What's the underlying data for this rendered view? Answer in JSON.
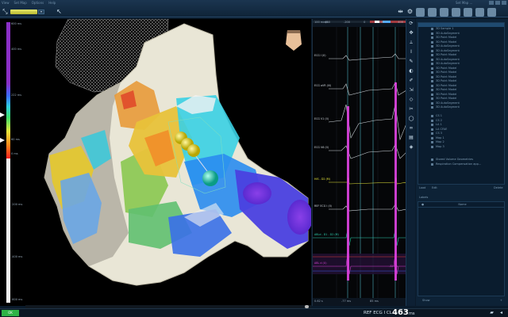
{
  "topbar": {
    "menu": [
      "View",
      "Set Map",
      "Options",
      "Help"
    ],
    "title_right": "Set Map ..."
  },
  "map_selector": {
    "value": "▾"
  },
  "scale": {
    "ticks": [
      {
        "label": "600 ms"
      },
      {
        "label": "400 ms"
      },
      {
        "label": "200 ms"
      },
      {
        "label": "0 ms"
      },
      {
        "label": "-200 ms"
      },
      {
        "label": "-400 ms"
      },
      {
        "label": "-600 ms"
      }
    ],
    "upper": "222 ms",
    "lower": "60 ms"
  },
  "ecg": {
    "speed": "100 mm/s",
    "times": [
      "-400",
      "-200",
      "0",
      "200",
      "400"
    ],
    "channels": [
      {
        "label": "ECG I (II)",
        "color": "#cfd6dc"
      },
      {
        "label": "ECG aVR (III)",
        "color": "#cfd6dc"
      },
      {
        "label": "ECG V1 (II)",
        "color": "#cfd6dc"
      },
      {
        "label": "ECG V6 (II)",
        "color": "#cfd6dc"
      },
      {
        "label": "HIS - D2 (M)",
        "color": "#e6e63a"
      },
      {
        "label": "REF ECG I (II)",
        "color": "#cfd6dc"
      },
      {
        "label": "ABLd - D1 - D2 (M)",
        "color": "#2fd0b0"
      },
      {
        "label": "ABL d (U)",
        "color": "#d040d0"
      }
    ],
    "right_value": "-32 ms",
    "bottom_left": "0.62 s",
    "bottom_mid1": "-77 ms",
    "bottom_mid2": "85 ms"
  },
  "right_panel": {
    "tree_rows": [
      "3D Sample 1",
      "3D AutoSegment",
      "3D Point Model",
      "3D Point Model",
      "3D AutoSegment",
      "3D AutoSegment",
      "3D Point Model",
      "3D AutoSegment",
      "3D AutoSegment",
      "3D Point Model",
      "3D Point Model",
      "3D Point Model",
      "3D Point Model",
      "3D Point Model",
      "3D Point Model",
      "3D Point Model",
      "3D Point Model",
      "3D AutoSegment",
      "3D AutoSegment",
      "",
      "CS 1",
      "CS 2",
      "LA 1",
      "LA CFAE",
      "CS 3",
      "Map 1",
      "Map 2",
      "Map 3",
      "",
      "",
      "Stored Volume Geometries",
      "Respiration Compensation app..."
    ],
    "sep_left": "Load",
    "sep_mid": "Edit",
    "sep_right": "Delete",
    "lower_title": "Labels",
    "lower_col": "Name",
    "lower_rows": [
      "",
      "",
      "",
      "",
      "",
      "",
      "",
      "",
      "",
      "",
      ""
    ],
    "lower_footer": "Show"
  },
  "status": {
    "ok_label": "OK",
    "ref": "REF ECG I CL",
    "cl_value": "463",
    "ms": "ms"
  }
}
